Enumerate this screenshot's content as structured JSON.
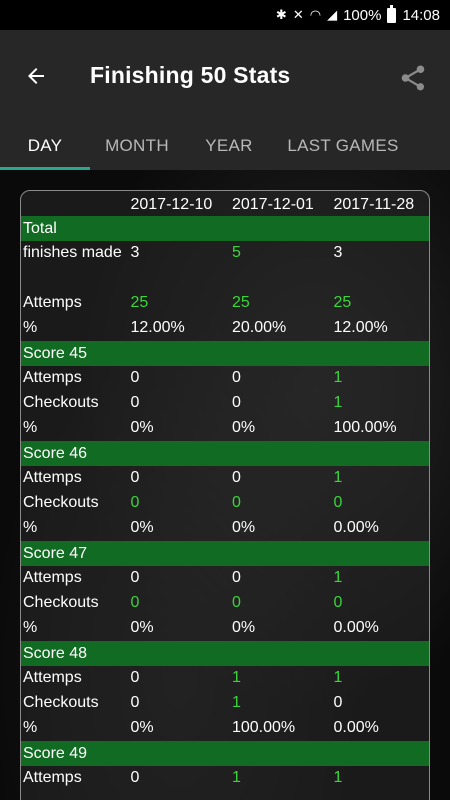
{
  "status": {
    "battery": "100%",
    "time": "14:08"
  },
  "header": {
    "title": "Finishing 50 Stats",
    "back_icon": "arrow-left-icon",
    "share_icon": "share-icon"
  },
  "tabs": [
    {
      "label": "DAY",
      "active": true
    },
    {
      "label": "MONTH",
      "active": false
    },
    {
      "label": "YEAR",
      "active": false
    },
    {
      "label": "LAST GAMES",
      "active": false
    }
  ],
  "table": {
    "columns": [
      "",
      "2017-12-10",
      "2017-12-01",
      "2017-11-28"
    ],
    "highlight_color": "#3cd43c",
    "section_color": "#126b22",
    "rows": [
      {
        "type": "section",
        "label": "Total"
      },
      {
        "type": "tall",
        "label": "finishes made",
        "values": [
          "3",
          "5",
          "3"
        ],
        "green": [
          false,
          true,
          false
        ]
      },
      {
        "type": "data",
        "label": "Attemps",
        "values": [
          "25",
          "25",
          "25"
        ],
        "green": [
          true,
          true,
          true
        ]
      },
      {
        "type": "data",
        "label": "%",
        "values": [
          "12.00%",
          "20.00%",
          "12.00%"
        ],
        "green": [
          false,
          false,
          false
        ]
      },
      {
        "type": "section",
        "label": "Score 45"
      },
      {
        "type": "data",
        "label": "Attemps",
        "values": [
          "0",
          "0",
          "1"
        ],
        "green": [
          false,
          false,
          true
        ]
      },
      {
        "type": "data",
        "label": "Checkouts",
        "values": [
          "0",
          "0",
          "1"
        ],
        "green": [
          false,
          false,
          true
        ]
      },
      {
        "type": "data",
        "label": "%",
        "values": [
          "0%",
          "0%",
          "100.00%"
        ],
        "green": [
          false,
          false,
          false
        ]
      },
      {
        "type": "section",
        "label": "Score 46"
      },
      {
        "type": "data",
        "label": "Attemps",
        "values": [
          "0",
          "0",
          "1"
        ],
        "green": [
          false,
          false,
          true
        ]
      },
      {
        "type": "data",
        "label": "Checkouts",
        "values": [
          "0",
          "0",
          "0"
        ],
        "green": [
          true,
          true,
          true
        ]
      },
      {
        "type": "data",
        "label": "%",
        "values": [
          "0%",
          "0%",
          "0.00%"
        ],
        "green": [
          false,
          false,
          false
        ]
      },
      {
        "type": "section",
        "label": "Score 47"
      },
      {
        "type": "data",
        "label": "Attemps",
        "values": [
          "0",
          "0",
          "1"
        ],
        "green": [
          false,
          false,
          true
        ]
      },
      {
        "type": "data",
        "label": "Checkouts",
        "values": [
          "0",
          "0",
          "0"
        ],
        "green": [
          true,
          true,
          true
        ]
      },
      {
        "type": "data",
        "label": "%",
        "values": [
          "0%",
          "0%",
          "0.00%"
        ],
        "green": [
          false,
          false,
          false
        ]
      },
      {
        "type": "section",
        "label": "Score 48"
      },
      {
        "type": "data",
        "label": "Attemps",
        "values": [
          "0",
          "1",
          "1"
        ],
        "green": [
          false,
          true,
          true
        ]
      },
      {
        "type": "data",
        "label": "Checkouts",
        "values": [
          "0",
          "1",
          "0"
        ],
        "green": [
          false,
          true,
          false
        ]
      },
      {
        "type": "data",
        "label": "%",
        "values": [
          "0%",
          "100.00%",
          "0.00%"
        ],
        "green": [
          false,
          false,
          false
        ]
      },
      {
        "type": "section",
        "label": "Score 49"
      },
      {
        "type": "data",
        "label": "Attemps",
        "values": [
          "0",
          "1",
          "1"
        ],
        "green": [
          false,
          true,
          true
        ]
      }
    ]
  }
}
